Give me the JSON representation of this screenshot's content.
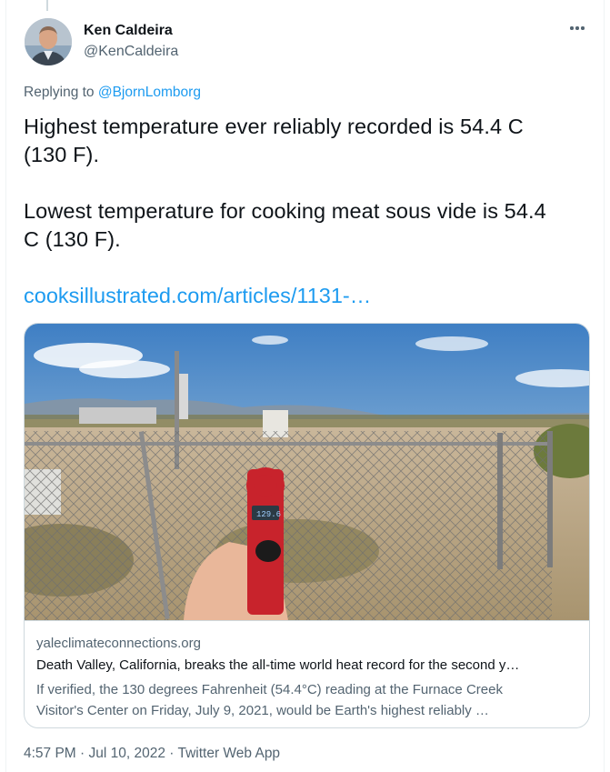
{
  "author": {
    "name": "Ken Caldeira",
    "handle": "@KenCaldeira"
  },
  "reply": {
    "prefix": "Replying to ",
    "to": "@BjornLomborg"
  },
  "tweet": {
    "line1": "Highest temperature ever reliably recorded is 54.4 C",
    "line2": "(130 F).",
    "line3": "Lowest temperature for cooking meat sous vide is 54.4",
    "line4": "C (130 F).",
    "link": "cooksillustrated.com/articles/1131-…"
  },
  "preview": {
    "domain": "yaleclimateconnections.org",
    "title": "Death Valley, California, breaks the all-time world heat record for the second y…",
    "desc_line1": "If verified, the 130 degrees Fahrenheit (54.4°C) reading at the Furnace Creek",
    "desc_line2": "Visitor's Center on Friday, July 9, 2021, would be Earth's highest reliably …",
    "thermometer_reading": "129.6"
  },
  "meta": {
    "time": "4:57 PM",
    "sep1": " · ",
    "date": "Jul 10, 2022",
    "sep2": " · ",
    "app": "Twitter Web App"
  }
}
